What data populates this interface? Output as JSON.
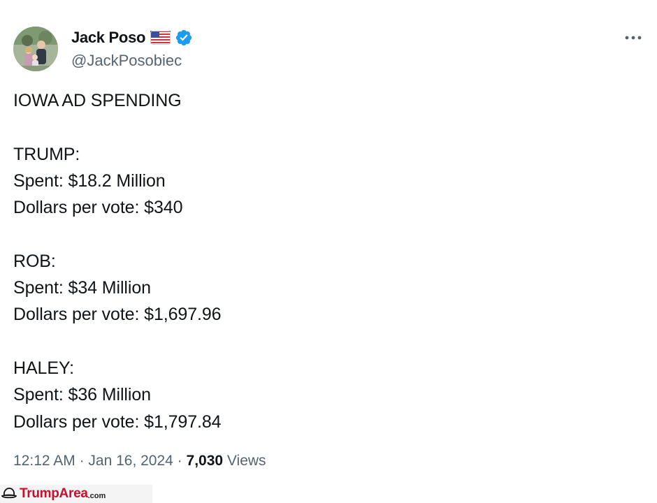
{
  "author": {
    "display_name": "Jack Poso",
    "handle": "@JackPosobiec",
    "flag": "us-flag-icon",
    "verified": "verified-badge-icon"
  },
  "tweet": {
    "lines": [
      "IOWA AD SPENDING",
      "",
      "TRUMP:",
      "Spent: $18.2 Million",
      "Dollars per vote: $340",
      "",
      "ROB:",
      "Spent: $34 Million",
      "Dollars per vote: $1,697.96",
      "",
      "HALEY:",
      "Spent: $36 Million",
      "Dollars per vote: $1,797.84"
    ]
  },
  "meta": {
    "time": "12:12 AM",
    "sep1": " · ",
    "date": "Jan 16, 2024",
    "sep2": " · ",
    "views_count": "7,030",
    "views_label": " Views"
  },
  "watermark": {
    "brand": "TrumpArea",
    "suffix": ".com"
  },
  "colors": {
    "text": "#0f1419",
    "secondary": "#536471",
    "verified": "#1d9bf0",
    "watermark": "#c8102e"
  }
}
